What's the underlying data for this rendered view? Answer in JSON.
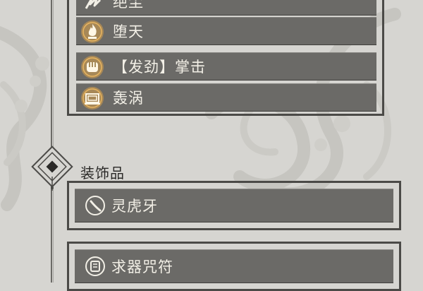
{
  "skills": [
    {
      "label": "绝尘",
      "icon": "dash-slash-icon",
      "highlighted": false
    },
    {
      "label": "堕天",
      "icon": "flame-icon",
      "highlighted": true
    },
    {
      "label": "【发劲】掌击",
      "icon": "fist-icon",
      "highlighted": true
    },
    {
      "label": "轰涡",
      "icon": "vortex-icon",
      "highlighted": true
    }
  ],
  "accessories": {
    "section_title": "装饰品",
    "section_icon": "diamond-emblem-icon",
    "items": [
      {
        "label": "灵虎牙",
        "icon": "fang-icon"
      },
      {
        "label": "求器咒符",
        "icon": "talisman-icon"
      }
    ]
  },
  "colors": {
    "background": "#d6d5d1",
    "row_fill": "#6b6a67",
    "frame": "#4b4a47",
    "text_light": "#f2efe6",
    "accent_gold": "#d9a14a"
  }
}
